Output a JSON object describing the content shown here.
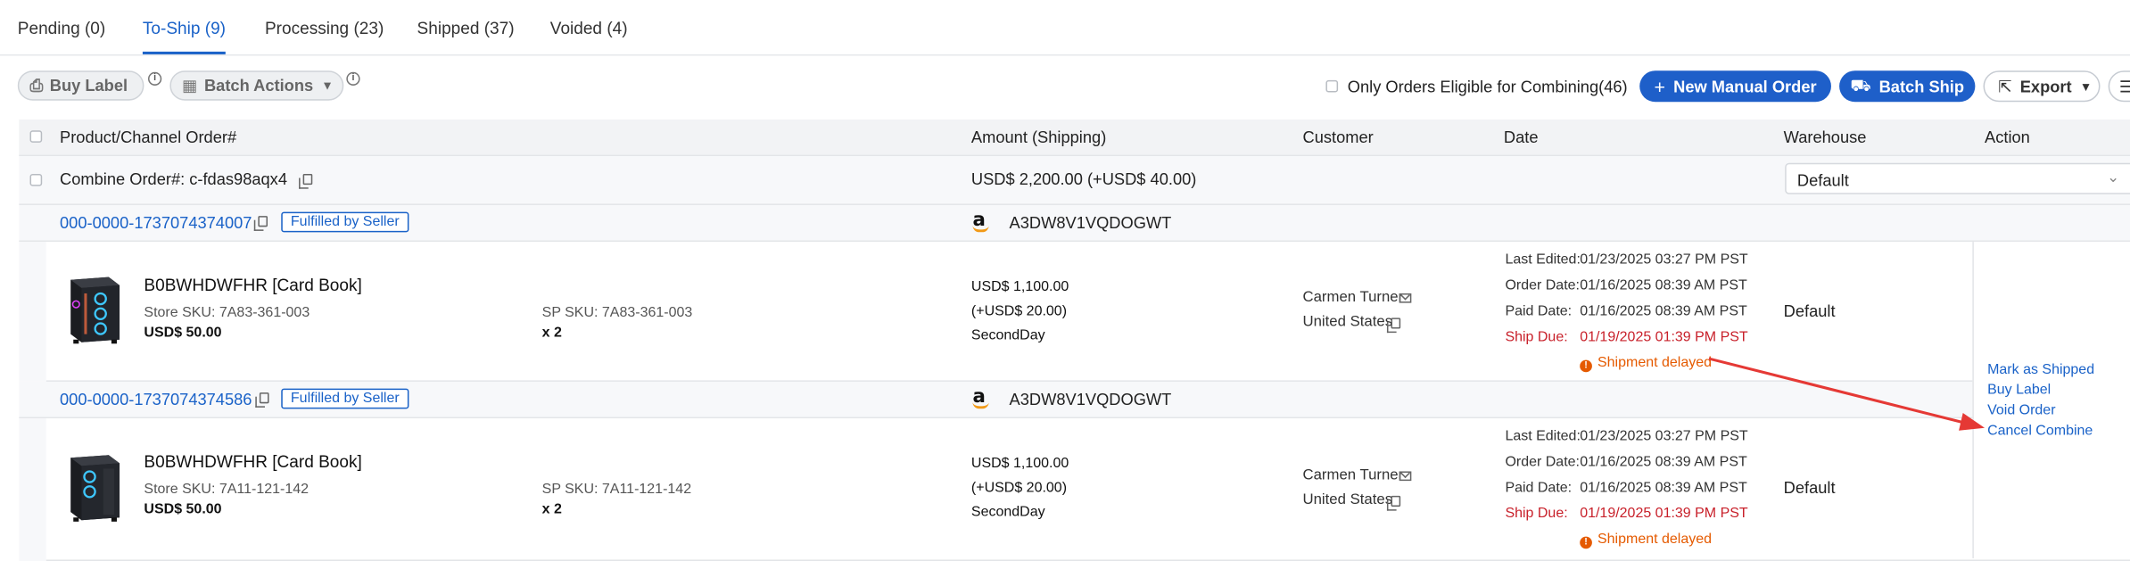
{
  "tabs": [
    {
      "label": "Pending (0)",
      "active": false
    },
    {
      "label": "To-Ship (9)",
      "active": true
    },
    {
      "label": "Processing (23)",
      "active": false
    },
    {
      "label": "Shipped (37)",
      "active": false
    },
    {
      "label": "Voided (4)",
      "active": false
    }
  ],
  "toolbar": {
    "buy_label": "Buy Label",
    "batch_actions": "Batch Actions",
    "combine_filter": "Only Orders Eligible for Combining(46)",
    "new_manual_order": "New Manual Order",
    "batch_ship": "Batch Ship",
    "export": "Export"
  },
  "table": {
    "headers": {
      "product": "Product/Channel Order#",
      "amount": "Amount (Shipping)",
      "customer": "Customer",
      "date": "Date",
      "warehouse": "Warehouse",
      "action": "Action"
    },
    "combine": {
      "order": "Combine Order#: c-fdas98aqx4",
      "amount": "USD$ 2,200.00 (+USD$ 40.00)",
      "warehouse": "Default"
    },
    "orders": [
      {
        "order_id": "000-0000-1737074374007",
        "fulfillment": "Fulfilled by Seller",
        "channel_logo": "a",
        "channel_account": "A3DW8V1VQDOGWT",
        "product_name": "B0BWHDWFHR [Card Book]",
        "store_sku": "Store SKU: 7A83-361-003",
        "sp_sku": "SP SKU: 7A83-361-003",
        "unit_price": "USD$ 50.00",
        "qty": "x 2",
        "amount": "USD$ 1,100.00",
        "shipping": "(+USD$ 20.00)",
        "service": "SecondDay",
        "customer_name": "Carmen Turner",
        "customer_country": "United States",
        "dates": [
          {
            "label": "Last Edited:",
            "value": "01/23/2025 03:27 PM PST"
          },
          {
            "label": "Order Date:",
            "value": "01/16/2025 08:39 AM PST"
          },
          {
            "label": "Paid Date:",
            "value": "01/16/2025 08:39 AM PST"
          },
          {
            "label": "Ship Due:",
            "value": "01/19/2025 01:39 PM PST"
          }
        ],
        "warning": "Shipment delayed",
        "warehouse": "Default"
      },
      {
        "order_id": "000-0000-1737074374586",
        "fulfillment": "Fulfilled by Seller",
        "channel_logo": "a",
        "channel_account": "A3DW8V1VQDOGWT",
        "product_name": "B0BWHDWFHR [Card Book]",
        "store_sku": "Store SKU: 7A11-121-142",
        "sp_sku": "SP SKU: 7A11-121-142",
        "unit_price": "USD$ 50.00",
        "qty": "x 2",
        "amount": "USD$ 1,100.00",
        "shipping": "(+USD$ 20.00)",
        "service": "SecondDay",
        "customer_name": "Carmen Turner",
        "customer_country": "United States",
        "dates": [
          {
            "label": "Last Edited:",
            "value": "01/23/2025 03:27 PM PST"
          },
          {
            "label": "Order Date:",
            "value": "01/16/2025 08:39 AM PST"
          },
          {
            "label": "Paid Date:",
            "value": "01/16/2025 08:39 AM PST"
          },
          {
            "label": "Ship Due:",
            "value": "01/19/2025 01:39 PM PST"
          }
        ],
        "warning": "Shipment delayed",
        "warehouse": "Default"
      }
    ]
  },
  "actions": [
    "Mark as Shipped",
    "Buy Label",
    "Void Order",
    "Cancel Combine"
  ],
  "colors": {
    "primary": "#1e5fc9",
    "link": "#1a62c8",
    "danger": "#c8202a",
    "warning": "#e55a00",
    "annotation_arrow": "#e53935"
  }
}
